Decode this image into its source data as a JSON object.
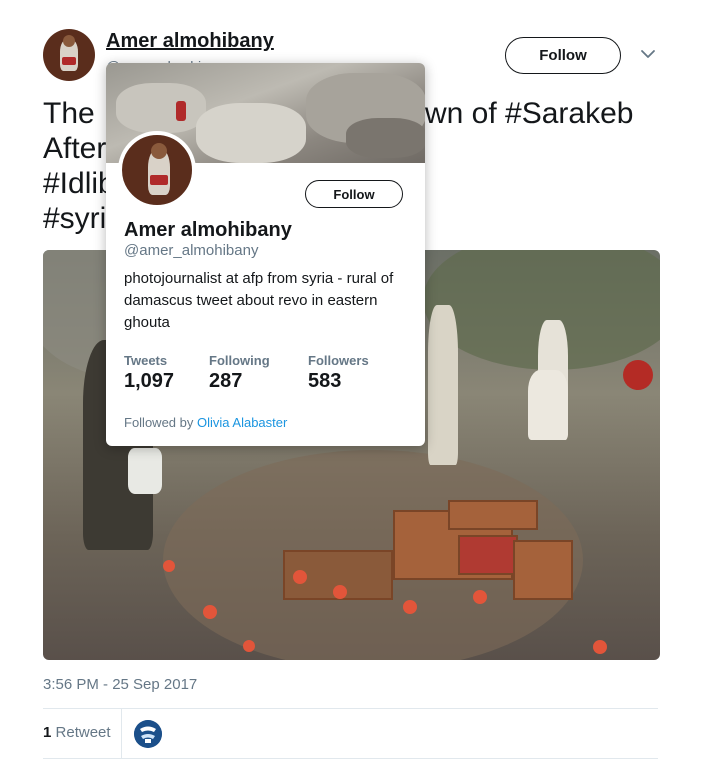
{
  "colors": {
    "text_primary": "#14171a",
    "text_secondary": "#657786",
    "link": "#1b95e0",
    "divider": "#e1e8ed"
  },
  "tweet": {
    "author_name": "Amer almohibany",
    "author_handle_partial": "@amer_almohi",
    "follow_label": "Follow",
    "caret_icon": "chevron-down-icon",
    "text_lines": [
      "The",
      "After",
      "#Idlib",
      "#syri"
    ],
    "text_line_1_right": "wn of #Sarakeb",
    "timestamp": "3:56 PM - 25 Sep 2017",
    "retweet_count": "1",
    "retweet_label": "Retweet"
  },
  "hover_card": {
    "name": "Amer almohibany",
    "handle": "@amer_almohibany",
    "follow_label": "Follow",
    "bio": "photojournalist at afp from syria - rural of damascus tweet about revo in eastern ghouta",
    "stats": [
      {
        "label": "Tweets",
        "value": "1,097"
      },
      {
        "label": "Following",
        "value": "287"
      },
      {
        "label": "Followers",
        "value": "583"
      }
    ],
    "followed_by_prefix": "Followed by",
    "followed_by_name": "Olivia Alabaster"
  }
}
